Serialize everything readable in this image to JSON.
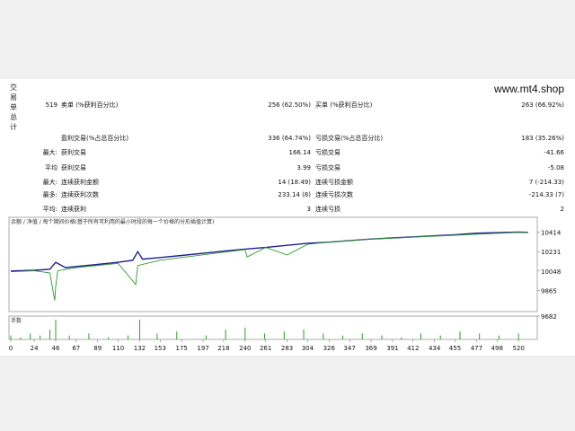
{
  "watermark": "www.mt4.shop",
  "side_label": [
    "交",
    "易",
    "单",
    "总",
    "计"
  ],
  "rows": [
    {
      "label": "519",
      "c1": "卖单 (%获利百分比)",
      "v1": "256 (62.50%)",
      "c2": "买单 (%获利百分比)",
      "v2": "263 (66.92%)"
    },
    {
      "label": "",
      "c1": "盈利交易(%占总百分比)",
      "v1": "336 (64.74%)",
      "c2": "亏损交易(%占总百分比)",
      "v2": "183 (35.26%)"
    },
    {
      "label": "最大:",
      "c1": "获利交易",
      "v1": "166.14",
      "c2": "亏损交易",
      "v2": "-41.66"
    },
    {
      "label": "平均",
      "c1": "获利交易",
      "v1": "3.99",
      "c2": "亏损交易",
      "v2": "-5.08"
    },
    {
      "label": "最大:",
      "c1": "连续获利金额",
      "v1": "14 (18.49)",
      "c2": "连续亏损金额",
      "v2": "7 (-214.33)"
    },
    {
      "label": "最多:",
      "c1": "连续获利次数",
      "v1": "233.14 (8)",
      "c2": "连续亏损次数",
      "v2": "-214.33 (7)"
    },
    {
      "label": "平均:",
      "c1": "连续获利",
      "v1": "3",
      "c2": "连续亏损",
      "v2": "2"
    }
  ],
  "chart_data": {
    "type": "line",
    "legend_text": "余额 / 净值 / 每个期间价格(基于所有可利用的最小时段的每一个价格的分形插值计算)",
    "series": [
      {
        "name": "余额",
        "color": "#1f1f8f",
        "x": [
          0,
          24,
          40,
          46,
          50,
          56,
          67,
          89,
          110,
          125,
          130,
          135,
          153,
          175,
          197,
          218,
          240,
          261,
          283,
          304,
          326,
          347,
          369,
          391,
          412,
          434,
          455,
          477,
          498,
          520,
          530
        ],
        "y": [
          10048,
          10055,
          10065,
          10130,
          10110,
          10080,
          10090,
          10110,
          10130,
          10150,
          10230,
          10160,
          10175,
          10195,
          10215,
          10235,
          10255,
          10270,
          10290,
          10310,
          10320,
          10335,
          10350,
          10360,
          10370,
          10380,
          10390,
          10405,
          10410,
          10415,
          10412
        ]
      },
      {
        "name": "净值",
        "color": "#2e9b2e",
        "x": [
          0,
          24,
          40,
          45,
          46,
          48,
          67,
          110,
          128,
          130,
          153,
          240,
          242,
          261,
          283,
          304,
          326,
          347,
          369,
          520,
          530
        ],
        "y": [
          10040,
          10050,
          10030,
          9770,
          9900,
          10050,
          10080,
          10120,
          9920,
          10100,
          10150,
          10250,
          10180,
          10270,
          10200,
          10300,
          10320,
          10335,
          10350,
          10412,
          10410
        ]
      }
    ],
    "xticks": [
      "0",
      "24",
      "46",
      "67",
      "89",
      "110",
      "132",
      "153",
      "175",
      "197",
      "218",
      "240",
      "261",
      "283",
      "304",
      "326",
      "347",
      "369",
      "391",
      "412",
      "434",
      "455",
      "477",
      "498",
      "520"
    ],
    "yticks": [
      "10414",
      "10231",
      "10048",
      "9865",
      "9682"
    ],
    "ylim": [
      9682,
      10470
    ],
    "xlim": [
      0,
      530
    ],
    "volume_label": "手数",
    "volume": {
      "x": [
        0,
        10,
        20,
        30,
        40,
        46,
        60,
        80,
        100,
        120,
        132,
        150,
        170,
        200,
        220,
        240,
        260,
        280,
        300,
        320,
        340,
        360,
        380,
        400,
        420,
        440,
        460,
        480,
        500,
        520
      ],
      "y": [
        0.2,
        0.1,
        0.3,
        0.2,
        0.5,
        1,
        0.2,
        0.3,
        0.1,
        0.2,
        1,
        0.3,
        0.4,
        0.2,
        0.5,
        0.6,
        0.3,
        0.4,
        0.5,
        0.3,
        0.2,
        0.3,
        0.2,
        0.1,
        0.3,
        0.2,
        0.4,
        0.3,
        0.2,
        0.3
      ]
    }
  }
}
